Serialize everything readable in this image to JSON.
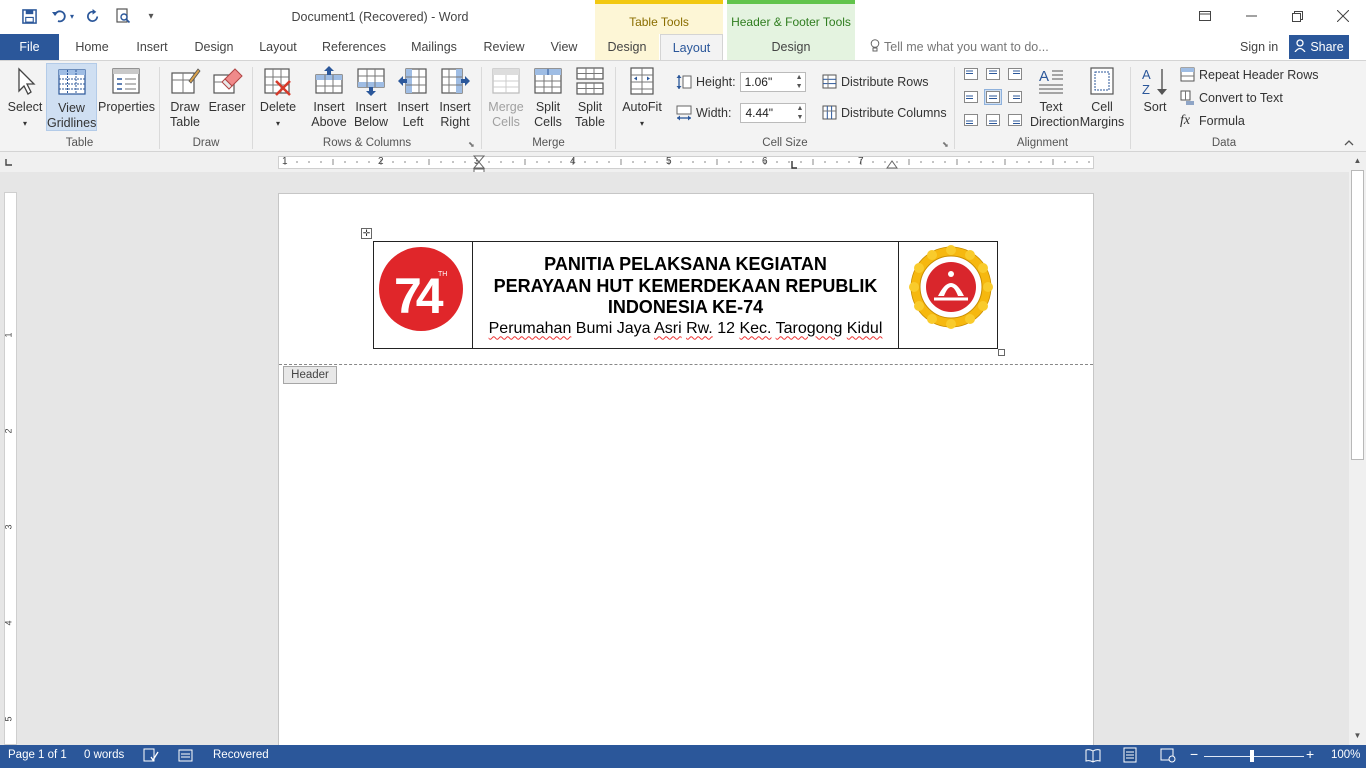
{
  "app": {
    "title": "Document1 (Recovered) - Word",
    "contextual_tabs": {
      "table_tools": "Table Tools",
      "header_footer_tools": "Header & Footer Tools"
    }
  },
  "tabs": {
    "file": "File",
    "items": [
      "Home",
      "Insert",
      "Design",
      "Layout",
      "References",
      "Mailings",
      "Review",
      "View",
      "Design",
      "Layout",
      "Design"
    ],
    "active": "Layout",
    "tell_me": "Tell me what you want to do...",
    "sign_in": "Sign in",
    "share": "Share"
  },
  "ribbon": {
    "table": {
      "label": "Table",
      "select": "Select",
      "view_gridlines_1": "View",
      "view_gridlines_2": "Gridlines",
      "properties": "Properties"
    },
    "draw": {
      "label": "Draw",
      "draw_table_1": "Draw",
      "draw_table_2": "Table",
      "eraser": "Eraser"
    },
    "rows_columns": {
      "label": "Rows & Columns",
      "delete": "Delete",
      "insert_above_1": "Insert",
      "insert_above_2": "Above",
      "insert_below_1": "Insert",
      "insert_below_2": "Below",
      "insert_left_1": "Insert",
      "insert_left_2": "Left",
      "insert_right_1": "Insert",
      "insert_right_2": "Right"
    },
    "merge": {
      "label": "Merge",
      "merge_cells_1": "Merge",
      "merge_cells_2": "Cells",
      "split_cells_1": "Split",
      "split_cells_2": "Cells",
      "split_table_1": "Split",
      "split_table_2": "Table"
    },
    "cell_size": {
      "label": "Cell Size",
      "autofit": "AutoFit",
      "height_label": "Height:",
      "height_value": "1.06\"",
      "width_label": "Width:",
      "width_value": "4.44\"",
      "distribute_rows": "Distribute Rows",
      "distribute_columns": "Distribute Columns"
    },
    "alignment": {
      "label": "Alignment",
      "text_direction_1": "Text",
      "text_direction_2": "Direction",
      "cell_margins_1": "Cell",
      "cell_margins_2": "Margins"
    },
    "data": {
      "label": "Data",
      "sort": "Sort",
      "repeat_header_rows": "Repeat Header Rows",
      "convert_to_text": "Convert to Text",
      "formula": "Formula"
    }
  },
  "ruler": {
    "marks": [
      "1",
      "2",
      "3",
      "4",
      "5",
      "6",
      "7"
    ],
    "vmarks": [
      "1",
      "2",
      "3",
      "4",
      "5"
    ]
  },
  "document": {
    "heading_lines": [
      "PANITIA PELAKSANA KEGIATAN",
      "PERAYAAN HUT KEMERDEKAAN REPUBLIK",
      "INDONESIA KE-74"
    ],
    "address": {
      "a": "Perumahan",
      "b": "Bumi",
      "c": "Jaya",
      "d": "Asri",
      "e": "Rw.",
      "f": "12",
      "g": "Kec.",
      "h": "Tarogong",
      "i": "Kidul"
    },
    "logo_text": "74",
    "logo_sup": "TH",
    "header_label": "Header"
  },
  "status": {
    "page": "Page 1 of 1",
    "words": "0 words",
    "recovered": "Recovered",
    "zoom": "100%"
  },
  "colors": {
    "accent": "#2b579a",
    "table_tools": "#f2c811",
    "header_footer_tools": "#62c44c",
    "logo_red": "#e0262a"
  }
}
